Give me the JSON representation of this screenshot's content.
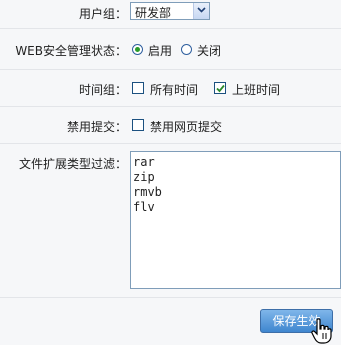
{
  "user_group": {
    "label": "用户组：",
    "selected": "研发部"
  },
  "web_security": {
    "label": "WEB安全管理状态：",
    "options": [
      "启用",
      "关闭"
    ],
    "selected": "启用"
  },
  "time_group": {
    "label": "时间组：",
    "options": [
      {
        "text": "所有时间",
        "checked": false
      },
      {
        "text": "上班时间",
        "checked": true
      }
    ]
  },
  "disable_submit": {
    "label": "禁用提交：",
    "option": {
      "text": "禁用网页提交",
      "checked": false
    }
  },
  "file_filter": {
    "label": "文件扩展类型过滤：",
    "lines": [
      "rar",
      "zip",
      "rmvb",
      "flv"
    ]
  },
  "save_button": {
    "label": "保存生效"
  },
  "colors": {
    "accent": "#3f86cf",
    "radio_dot": "#2a9b2a",
    "check": "#1c5180"
  }
}
